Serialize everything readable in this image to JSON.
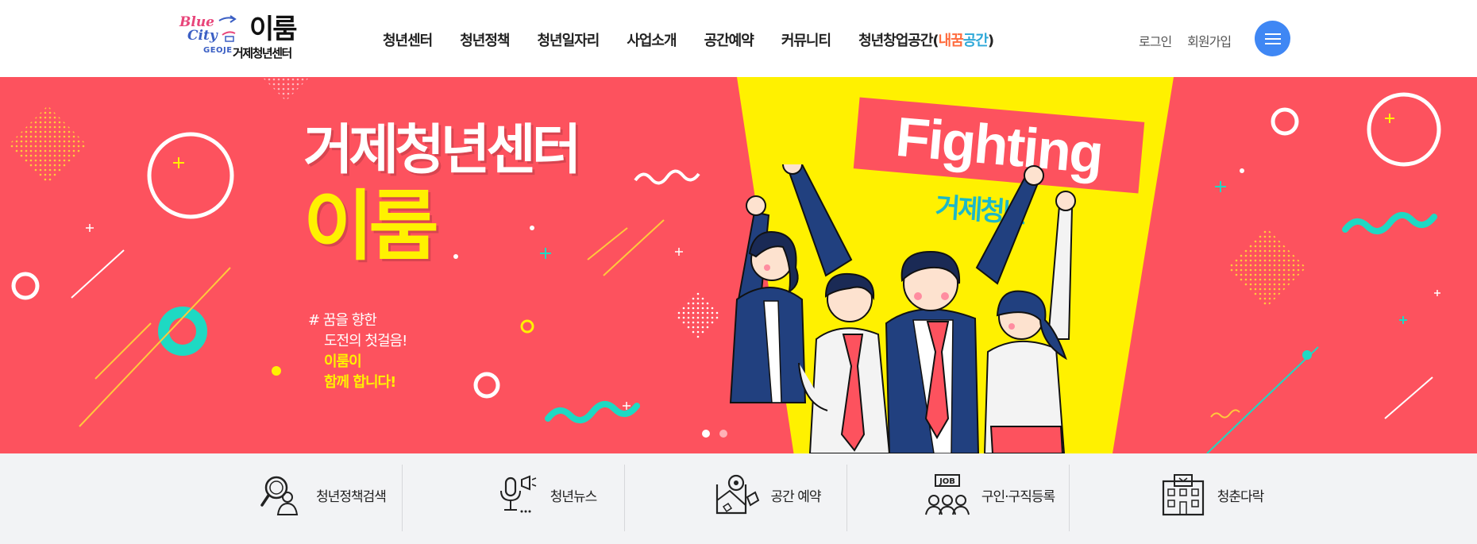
{
  "header": {
    "logo": {
      "blue": "Blue",
      "city": "City",
      "geoje": "GEOJE",
      "name": "이룸",
      "subtitle": "거제청년센터"
    },
    "nav": [
      {
        "label": "청년센터"
      },
      {
        "label": "청년정책"
      },
      {
        "label": "청년일자리"
      },
      {
        "label": "사업소개"
      },
      {
        "label": "공간예약"
      },
      {
        "label": "커뮤니티"
      }
    ],
    "nav_last": {
      "prefix": "청년창업공간(",
      "hl1": "내꿈",
      "hl2": "공간",
      "suffix": ")"
    },
    "util": {
      "login": "로그인",
      "signup": "회원가입"
    },
    "menu_icon": "hamburger-icon"
  },
  "banner": {
    "title": "거제청년센터",
    "subtitle": "이룸",
    "copy_line1": "# 꿈을 향한",
    "copy_line2": "도전의 첫걸음!",
    "copy_line3": "이룸이",
    "copy_line4": "함께 합니다!",
    "board_text": "Fighting",
    "board_sub": "거제청년",
    "slides": 2,
    "active_slide": 1,
    "colors": {
      "background": "#fd525e",
      "beam": "#fff100",
      "accent": "#1cb8c8"
    }
  },
  "quick_menu": [
    {
      "label": "청년정책검색",
      "icon": "policy-search-icon"
    },
    {
      "label": "청년뉴스",
      "icon": "microphone-news-icon"
    },
    {
      "label": "공간 예약",
      "icon": "map-reservation-icon"
    },
    {
      "label": "구인·구직등록",
      "icon": "job-people-icon"
    },
    {
      "label": "청춘다락",
      "icon": "building-icon"
    }
  ]
}
